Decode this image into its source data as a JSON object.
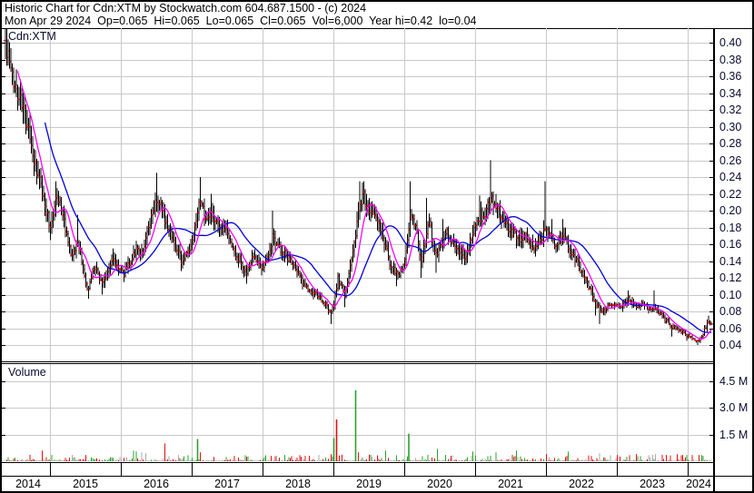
{
  "header": {
    "line1": "Historic Chart for Cdn:XTM by Stockwatch.com 604.687.1500 - (c) 2024",
    "line2": "Mon Apr 29 2024  Op=0.065  Hi=0.065  Lo=0.065  Cl=0.065  Vol=6,000  Year hi=0.42  lo=0.04"
  },
  "price_panel": {
    "label": "Cdn:XTM"
  },
  "volume_panel": {
    "label": "Volume"
  },
  "colors": {
    "bar": "#000000",
    "open_close_tick": "#dd0000",
    "ma_short": "#ff00ff",
    "ma_long": "#0000dd",
    "vol_up": "#2ea02e",
    "vol_down": "#dd1111",
    "vol_flat": "#a8a8a8",
    "grid": "#c9c9c9",
    "axis_text": "#0a0a30"
  },
  "chart_data": {
    "type": "ohlc",
    "title": "Historic Chart for Cdn:XTM by Stockwatch.com 604.687.1500 - (c) 2024",
    "symbol": "Cdn:XTM",
    "last_quote": {
      "date": "Mon Apr 29 2024",
      "open": 0.065,
      "high": 0.065,
      "low": 0.065,
      "close": 0.065,
      "volume": 6000,
      "year_high": 0.42,
      "year_low": 0.04
    },
    "price_axis": {
      "ticks": [
        0.4,
        0.38,
        0.36,
        0.34,
        0.32,
        0.3,
        0.28,
        0.26,
        0.24,
        0.22,
        0.2,
        0.18,
        0.16,
        0.14,
        0.12,
        0.1,
        0.08,
        0.06,
        0.04
      ],
      "step": 0.02
    },
    "volume_axis": {
      "ticks": [
        4.5,
        3.0,
        1.5
      ],
      "unit": "M"
    },
    "years": [
      "2014",
      "2015",
      "2016",
      "2017",
      "2018",
      "2019",
      "2020",
      "2021",
      "2022",
      "2023",
      "2024"
    ],
    "year_tick_x": [
      55,
      133,
      211,
      289,
      367,
      445,
      523,
      601,
      679,
      757
    ],
    "year_label_x": [
      31,
      94,
      172,
      250,
      328,
      406,
      484,
      562,
      640,
      718,
      769
    ],
    "grid": true,
    "legend": "none",
    "moving_averages": [
      {
        "name": "short-term average",
        "window": 10,
        "color_key": "ma_short"
      },
      {
        "name": "long-term average",
        "window": 30,
        "color_key": "ma_long"
      }
    ],
    "price_anchors": [
      [
        6,
        0.4,
        0.415,
        0.385
      ],
      [
        10,
        0.375
      ],
      [
        14,
        0.355
      ],
      [
        18,
        0.345
      ],
      [
        22,
        0.335
      ],
      [
        26,
        0.32
      ],
      [
        30,
        0.3
      ],
      [
        34,
        0.28
      ],
      [
        38,
        0.255
      ],
      [
        42,
        0.24
      ],
      [
        46,
        0.225
      ],
      [
        50,
        0.205
      ],
      [
        55,
        0.18,
        null,
        0.165
      ],
      [
        58,
        0.195
      ],
      [
        62,
        0.22,
        0.235,
        null
      ],
      [
        66,
        0.21
      ],
      [
        70,
        0.19
      ],
      [
        74,
        0.165
      ],
      [
        78,
        0.145
      ],
      [
        82,
        0.15
      ],
      [
        86,
        0.165,
        0.195,
        null
      ],
      [
        90,
        0.14
      ],
      [
        94,
        0.115
      ],
      [
        97,
        0.105,
        null,
        0.095
      ],
      [
        100,
        0.12
      ],
      [
        104,
        0.135
      ],
      [
        108,
        0.125
      ],
      [
        112,
        0.115,
        null,
        0.1
      ],
      [
        116,
        0.12
      ],
      [
        120,
        0.13
      ],
      [
        124,
        0.145,
        0.155,
        null
      ],
      [
        128,
        0.135
      ],
      [
        132,
        0.13
      ],
      [
        136,
        0.125,
        null,
        0.115
      ],
      [
        140,
        0.135
      ],
      [
        144,
        0.14
      ],
      [
        148,
        0.15
      ],
      [
        152,
        0.155
      ],
      [
        156,
        0.148
      ],
      [
        160,
        0.163
      ],
      [
        164,
        0.178
      ],
      [
        168,
        0.2
      ],
      [
        172,
        0.215,
        0.245,
        null
      ],
      [
        176,
        0.208
      ],
      [
        180,
        0.195
      ],
      [
        184,
        0.185
      ],
      [
        188,
        0.175
      ],
      [
        192,
        0.16
      ],
      [
        196,
        0.15
      ],
      [
        200,
        0.14,
        null,
        0.128
      ],
      [
        204,
        0.145
      ],
      [
        208,
        0.152
      ],
      [
        212,
        0.162
      ],
      [
        216,
        0.185
      ],
      [
        220,
        0.21,
        0.24,
        null
      ],
      [
        224,
        0.198
      ],
      [
        228,
        0.188
      ],
      [
        232,
        0.198,
        0.22,
        null
      ],
      [
        236,
        0.188
      ],
      [
        240,
        0.18
      ],
      [
        244,
        0.175
      ],
      [
        248,
        0.18
      ],
      [
        252,
        0.168
      ],
      [
        256,
        0.155
      ],
      [
        260,
        0.147
      ],
      [
        264,
        0.14
      ],
      [
        268,
        0.132
      ],
      [
        272,
        0.125,
        null,
        0.113
      ],
      [
        276,
        0.14
      ],
      [
        280,
        0.147
      ],
      [
        284,
        0.14
      ],
      [
        288,
        0.132
      ],
      [
        292,
        0.14
      ],
      [
        296,
        0.152
      ],
      [
        300,
        0.168,
        0.2,
        null
      ],
      [
        304,
        0.163
      ],
      [
        308,
        0.155
      ],
      [
        312,
        0.15
      ],
      [
        316,
        0.145
      ],
      [
        320,
        0.14
      ],
      [
        324,
        0.135
      ],
      [
        328,
        0.125
      ],
      [
        332,
        0.117
      ],
      [
        336,
        0.11
      ],
      [
        340,
        0.105
      ],
      [
        344,
        0.102
      ],
      [
        348,
        0.1
      ],
      [
        352,
        0.095
      ],
      [
        356,
        0.09
      ],
      [
        360,
        0.085
      ],
      [
        364,
        0.077,
        null,
        0.065
      ],
      [
        368,
        0.09
      ],
      [
        372,
        0.12
      ],
      [
        376,
        0.11
      ],
      [
        380,
        0.098,
        null,
        0.085
      ],
      [
        384,
        0.125
      ],
      [
        388,
        0.15
      ],
      [
        392,
        0.175
      ],
      [
        396,
        0.21,
        0.235,
        null
      ],
      [
        400,
        0.218,
        0.235,
        null
      ],
      [
        404,
        0.205
      ],
      [
        408,
        0.196
      ],
      [
        412,
        0.2
      ],
      [
        416,
        0.19
      ],
      [
        420,
        0.172
      ],
      [
        424,
        0.158
      ],
      [
        428,
        0.142
      ],
      [
        432,
        0.132
      ],
      [
        436,
        0.126,
        null,
        0.11
      ],
      [
        440,
        0.122
      ],
      [
        444,
        0.136
      ],
      [
        448,
        0.16
      ],
      [
        452,
        0.2,
        0.235,
        null
      ],
      [
        456,
        0.186
      ],
      [
        460,
        0.168
      ],
      [
        463,
        0.138,
        null,
        0.12
      ],
      [
        466,
        0.152
      ],
      [
        470,
        0.176,
        0.215,
        null
      ],
      [
        473,
        0.186
      ],
      [
        476,
        0.162
      ],
      [
        480,
        0.147,
        null,
        0.126
      ],
      [
        484,
        0.156
      ],
      [
        488,
        0.17,
        0.19,
        null
      ],
      [
        492,
        0.176
      ],
      [
        496,
        0.166
      ],
      [
        500,
        0.16
      ],
      [
        504,
        0.156
      ],
      [
        508,
        0.15,
        null,
        0.136
      ],
      [
        512,
        0.146
      ],
      [
        516,
        0.156
      ],
      [
        520,
        0.17
      ],
      [
        524,
        0.184
      ],
      [
        528,
        0.194,
        0.218,
        null
      ],
      [
        532,
        0.19
      ],
      [
        536,
        0.204
      ],
      [
        540,
        0.218,
        0.26,
        null
      ],
      [
        544,
        0.21
      ],
      [
        548,
        0.2
      ],
      [
        552,
        0.196
      ],
      [
        556,
        0.186
      ],
      [
        560,
        0.18
      ],
      [
        564,
        0.176
      ],
      [
        568,
        0.17,
        null,
        0.155
      ],
      [
        572,
        0.166
      ],
      [
        576,
        0.17
      ],
      [
        580,
        0.166
      ],
      [
        584,
        0.16
      ],
      [
        588,
        0.156
      ],
      [
        592,
        0.16
      ],
      [
        596,
        0.166
      ],
      [
        600,
        0.176,
        0.235,
        null
      ],
      [
        604,
        0.17
      ],
      [
        608,
        0.166,
        0.19,
        null
      ],
      [
        612,
        0.16
      ],
      [
        616,
        0.166
      ],
      [
        620,
        0.17,
        0.19,
        null
      ],
      [
        624,
        0.16
      ],
      [
        628,
        0.15
      ],
      [
        632,
        0.144
      ],
      [
        636,
        0.136
      ],
      [
        640,
        0.126
      ],
      [
        644,
        0.12
      ],
      [
        648,
        0.11
      ],
      [
        652,
        0.1
      ],
      [
        656,
        0.09,
        null,
        0.075
      ],
      [
        660,
        0.084,
        null,
        0.065
      ],
      [
        664,
        0.08
      ],
      [
        668,
        0.086
      ],
      [
        672,
        0.09
      ],
      [
        676,
        0.086
      ],
      [
        680,
        0.09
      ],
      [
        684,
        0.086
      ],
      [
        688,
        0.09
      ],
      [
        692,
        0.096,
        0.105,
        null
      ],
      [
        696,
        0.09
      ],
      [
        700,
        0.086
      ],
      [
        704,
        0.086
      ],
      [
        708,
        0.09
      ],
      [
        712,
        0.086
      ],
      [
        716,
        0.08
      ],
      [
        720,
        0.086,
        0.105,
        null
      ],
      [
        724,
        0.08
      ],
      [
        728,
        0.076
      ],
      [
        732,
        0.07
      ],
      [
        736,
        0.066
      ],
      [
        740,
        0.06,
        null,
        0.05
      ],
      [
        744,
        0.06
      ],
      [
        748,
        0.056
      ],
      [
        752,
        0.056
      ],
      [
        756,
        0.05,
        null,
        0.045
      ],
      [
        760,
        0.05
      ],
      [
        764,
        0.048
      ],
      [
        768,
        0.045,
        null,
        0.04
      ],
      [
        772,
        0.05
      ],
      [
        776,
        0.06
      ],
      [
        780,
        0.07,
        0.075,
        null
      ],
      [
        783,
        0.065
      ]
    ],
    "volume_spikes_millions": [
      [
        46,
        0.6,
        "red"
      ],
      [
        95,
        0.35,
        "red"
      ],
      [
        147,
        0.6,
        "green"
      ],
      [
        150,
        0.55,
        "green"
      ],
      [
        156,
        0.5,
        "gray"
      ],
      [
        160,
        0.45,
        "gray"
      ],
      [
        182,
        1.0,
        "red"
      ],
      [
        218,
        1.25,
        "green"
      ],
      [
        220,
        0.5,
        "red"
      ],
      [
        258,
        0.3,
        "red"
      ],
      [
        298,
        0.3,
        "red"
      ],
      [
        313,
        0.35,
        "green"
      ],
      [
        340,
        0.3,
        "red"
      ],
      [
        365,
        0.4,
        "red"
      ],
      [
        367,
        1.3,
        "green"
      ],
      [
        370,
        2.45,
        "red"
      ],
      [
        371,
        2.35,
        "red"
      ],
      [
        392,
        4.0,
        "green"
      ],
      [
        394,
        0.5,
        "red"
      ],
      [
        424,
        0.6,
        "green"
      ],
      [
        450,
        1.55,
        "green"
      ],
      [
        481,
        0.7,
        "green"
      ],
      [
        520,
        0.55,
        "green"
      ],
      [
        546,
        0.5,
        "green"
      ],
      [
        568,
        0.6,
        "green"
      ],
      [
        601,
        0.4,
        "red"
      ],
      [
        625,
        0.55,
        "green"
      ],
      [
        660,
        0.45,
        "gray"
      ],
      [
        680,
        0.35,
        "red"
      ],
      [
        700,
        0.4,
        "red"
      ],
      [
        722,
        0.4,
        "gray"
      ],
      [
        734,
        0.35,
        "red"
      ],
      [
        745,
        0.4,
        "red"
      ],
      [
        752,
        0.35,
        "red"
      ],
      [
        756,
        0.35,
        "green"
      ],
      [
        762,
        0.35,
        "red"
      ],
      [
        770,
        0.35,
        "red"
      ],
      [
        774,
        0.3,
        "green"
      ]
    ]
  }
}
